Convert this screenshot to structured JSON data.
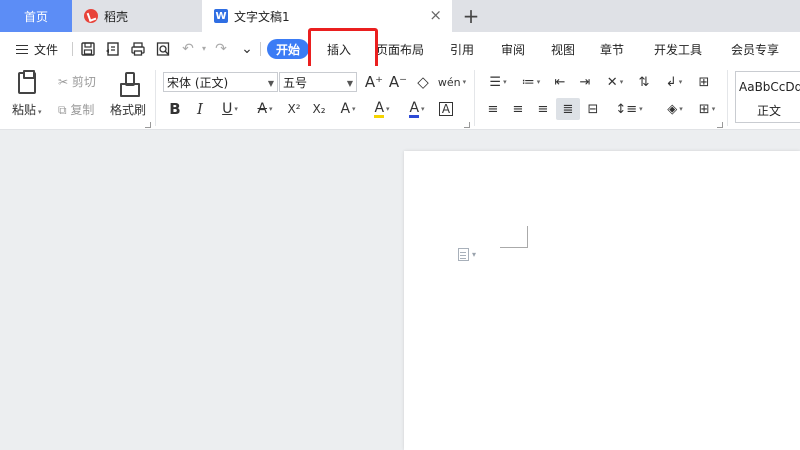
{
  "tabs": {
    "home": "首页",
    "daoke": "稻壳",
    "doc": "文字文稿1",
    "close_glyph": "×",
    "add_glyph": "+"
  },
  "menu": {
    "file": "文件",
    "undo_glyph": "↶",
    "redo_glyph": "↷",
    "more_glyph": "⌄",
    "tabs": [
      "开始",
      "插入",
      "页面布局",
      "引用",
      "审阅",
      "视图",
      "章节",
      "开发工具",
      "会员专享"
    ]
  },
  "ribbon": {
    "paste": "粘贴",
    "cut": "剪切",
    "copy": "复制",
    "format_painter": "格式刷",
    "font_name": "宋体 (正文)",
    "font_size": "五号",
    "grow_font": "A⁺",
    "shrink_font": "A⁻",
    "clear_format": "◇",
    "pinyin": "wén",
    "bold": "B",
    "italic": "I",
    "underline": "U",
    "strike": "A",
    "superscript": "X²",
    "subscript": "X₂",
    "text_effect": "A",
    "highlight": "A",
    "font_color": "A",
    "char_border": "A",
    "style_sample": "AaBbCcDd",
    "style_name": "正文"
  },
  "colors": {
    "home_tab": "#5c8df6",
    "start_pill": "#3b7cf5",
    "highlight_box": "#ea1f1f",
    "font_color_bar": "#2e4bd6",
    "highlight_bar": "#f5d400"
  }
}
